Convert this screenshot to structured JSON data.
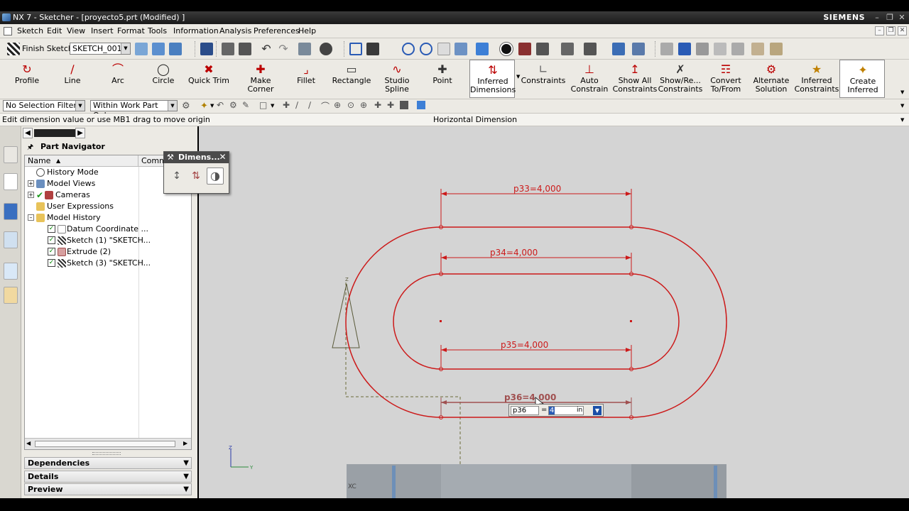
{
  "window": {
    "title": "NX 7 - Sketcher - [proyecto5.prt (Modified) ]",
    "brand": "SIEMENS"
  },
  "menu": [
    "Sketch",
    "Edit",
    "View",
    "Insert",
    "Format",
    "Tools",
    "Information",
    "Analysis",
    "Preferences",
    "Help"
  ],
  "toolbar1": {
    "finish_sketch": "Finish Sketch",
    "sketch_name": "SKETCH_001"
  },
  "toolbar2": {
    "profile": "Profile",
    "line": "Line",
    "arc": "Arc",
    "circle": "Circle",
    "quick_trim": "Quick Trim",
    "make_corner_1": "Make",
    "make_corner_2": "Corner",
    "fillet": "Fillet",
    "rectangle": "Rectangle",
    "studio_spline_1": "Studio",
    "studio_spline_2": "Spline",
    "point": "Point",
    "inferred_dim_1": "Inferred",
    "inferred_dim_2": "Dimensions",
    "constraints": "Constraints",
    "auto_constrain_1": "Auto",
    "auto_constrain_2": "Constrain",
    "show_all_1": "Show All",
    "show_all_2": "Constraints",
    "show_remove_1": "Show/Re...",
    "show_remove_2": "Constraints",
    "convert_1": "Convert",
    "convert_2": "To/From",
    "alternate_1": "Alternate",
    "alternate_2": "Solution",
    "inferred_c_1": "Inferred",
    "inferred_c_2": "Constraints",
    "create_inferred_1": "Create",
    "create_inferred_2": "Inferred"
  },
  "selection": {
    "filter": "No Selection Filter",
    "scope": "Within Work Part Only"
  },
  "cue": {
    "message": "Edit dimension value or use MB1 drag to move origin",
    "status": "Horizontal Dimension"
  },
  "navigator": {
    "title": "Part Navigator",
    "col_name": "Name",
    "col_comment": "Comm",
    "items": [
      {
        "label": "History Mode"
      },
      {
        "label": "Model Views"
      },
      {
        "label": "Cameras"
      },
      {
        "label": "User Expressions"
      },
      {
        "label": "Model History"
      },
      {
        "label": "Datum Coordinate ..."
      },
      {
        "label": "Sketch (1) \"SKETCH..."
      },
      {
        "label": "Extrude (2)"
      },
      {
        "label": "Sketch (3) \"SKETCH..."
      }
    ],
    "sections": [
      "Dependencies",
      "Details",
      "Preview"
    ]
  },
  "dim_palette": {
    "title": "Dimens..."
  },
  "sketch": {
    "dims": [
      "p33=4,000",
      "p34=4,000",
      "p35=4,000",
      "p36=4,000"
    ],
    "axis_z": "Z",
    "axis_y": "Y",
    "base_label": "XC"
  },
  "editbox": {
    "name": "p36",
    "eq": "=",
    "value": "4",
    "unit": "in"
  },
  "colors": {
    "sketch_red": "#cc1a1a",
    "background": "#d4d4d4",
    "dimension": "#a05050"
  }
}
